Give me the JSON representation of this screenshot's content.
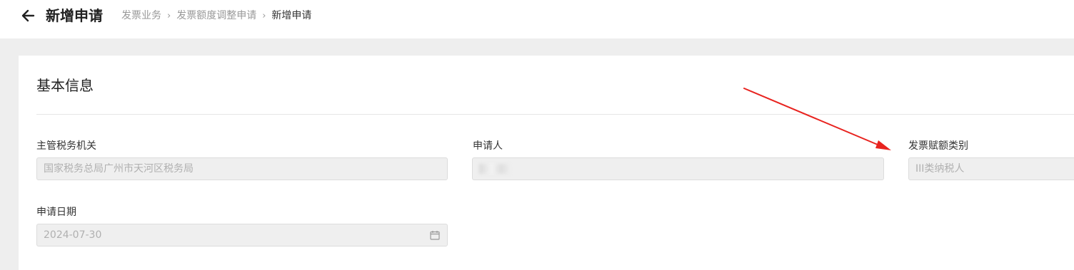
{
  "header": {
    "title": "新增申请",
    "breadcrumb": [
      {
        "label": "发票业务"
      },
      {
        "label": "发票额度调整申请"
      },
      {
        "label": "新增申请"
      }
    ]
  },
  "section": {
    "title": "基本信息"
  },
  "fields": {
    "tax_authority": {
      "label": "主管税务机关",
      "value": "国家税务总局广州市天河区税务局"
    },
    "applicant": {
      "label": "申请人",
      "value": ""
    },
    "invoice_category": {
      "label": "发票赋额类别",
      "value": "III类纳税人"
    },
    "apply_date": {
      "label": "申请日期",
      "value": "2024-07-30"
    }
  },
  "colors": {
    "annotation_arrow": "#e8231f",
    "disabled_input_bg": "#efefef",
    "page_bg": "#eeeeee"
  },
  "icons": {
    "back": "back-arrow-icon",
    "breadcrumb_separator": "chevron-right-icon",
    "date": "calendar-icon"
  }
}
